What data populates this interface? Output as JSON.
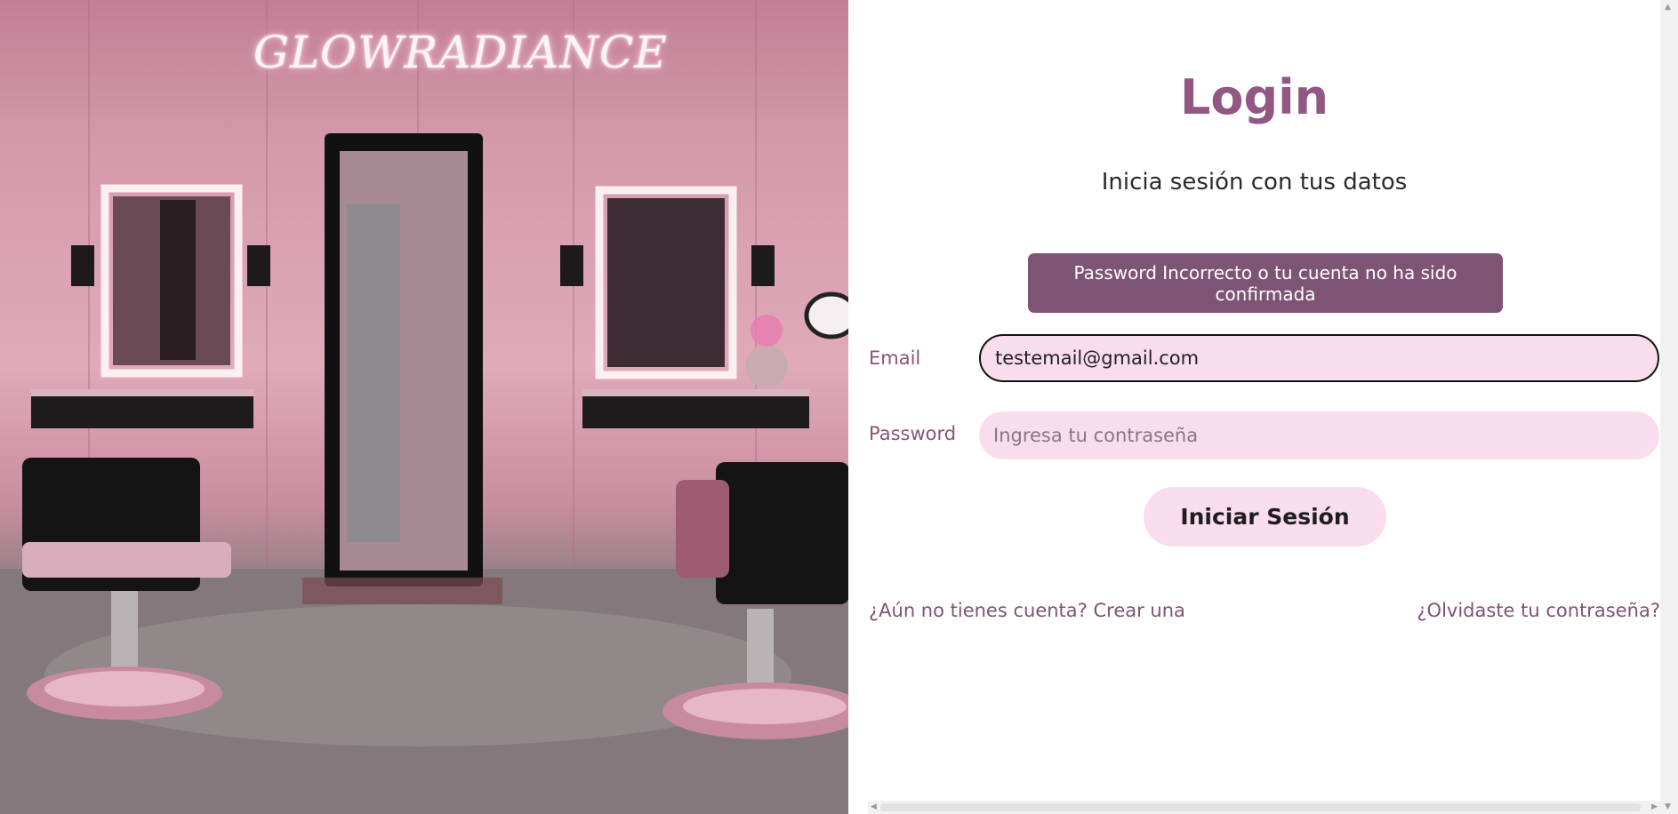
{
  "brand": {
    "name": "GLOWRADIANCE"
  },
  "login": {
    "title": "Login",
    "subtitle": "Inicia sesión con tus datos",
    "error_message": "Password Incorrecto o tu cuenta no ha sido confirmada",
    "email_label": "Email",
    "email_value": "testemail@gmail.com",
    "password_label": "Password",
    "password_placeholder": "Ingresa tu contraseña",
    "submit_label": "Iniciar Sesión",
    "register_link": "¿Aún no tienes cuenta? Crear una",
    "forgot_link": "¿Olvidaste tu contraseña?"
  },
  "colors": {
    "accent": "#925783",
    "error_bg": "#7e5474",
    "input_bg": "#fadcef",
    "link": "#7e5474"
  },
  "icons": {
    "scroll_up": "triangle-up-icon",
    "scroll_down": "triangle-down-icon",
    "scroll_left": "triangle-left-icon",
    "scroll_right": "triangle-right-icon"
  }
}
